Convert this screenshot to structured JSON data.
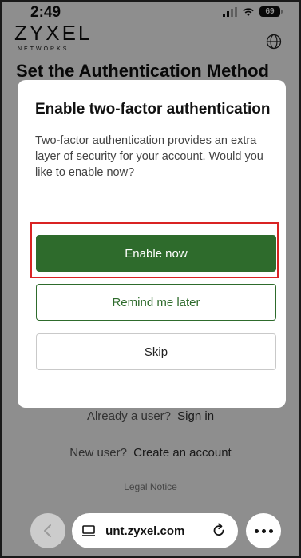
{
  "status": {
    "time": "2:49",
    "battery": "69"
  },
  "brand": {
    "name": "ZYXEL",
    "sub": "NETWORKS"
  },
  "page": {
    "title": "Set the Authentication Method",
    "existing_user_prompt": "Already a user?",
    "sign_in_link": "Sign in",
    "new_user_prompt": "New user?",
    "create_account_link": "Create an account",
    "legal_notice": "Legal Notice"
  },
  "modal": {
    "title": "Enable two-factor authentication",
    "body": "Two-factor authentication provides an extra layer of security for your account. Would you like to enable now?",
    "enable_label": "Enable now",
    "remind_label": "Remind me later",
    "skip_label": "Skip"
  },
  "browser": {
    "url": " unt.zyxel.com"
  },
  "colors": {
    "primary": "#2e6b2c",
    "highlight": "#d92323"
  },
  "icons": [
    "globe-icon",
    "wifi-icon",
    "signal-icon",
    "battery-icon",
    "chevron-left-icon",
    "tabs-icon",
    "reload-icon",
    "more-icon"
  ]
}
